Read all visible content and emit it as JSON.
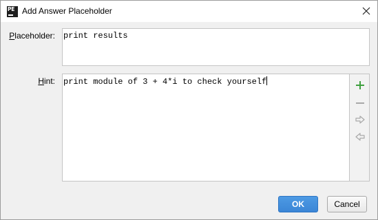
{
  "window": {
    "title": "Add Answer Placeholder",
    "app_icon_text": "PE",
    "app_icon": "pycharm-edu-icon",
    "close_icon": "close-icon"
  },
  "form": {
    "placeholder_label": "Placeholder:",
    "placeholder_mnemonic": "P",
    "placeholder_rest": "laceholder:",
    "placeholder_value": "print results",
    "hint_label": "Hint:",
    "hint_mnemonic": "H",
    "hint_rest": "int:",
    "hint_value": "print module of 3 + 4*i to check yourself"
  },
  "hint_toolbar": {
    "add_icon": "plus-icon",
    "remove_icon": "minus-icon",
    "next_icon": "arrow-right-icon",
    "prev_icon": "arrow-left-icon",
    "colors": {
      "add": "#3d9f3d",
      "disabled": "#a8a8a8"
    }
  },
  "buttons": {
    "ok_label": "OK",
    "cancel_label": "Cancel"
  },
  "colors": {
    "primary_button": "#3b86d6"
  }
}
